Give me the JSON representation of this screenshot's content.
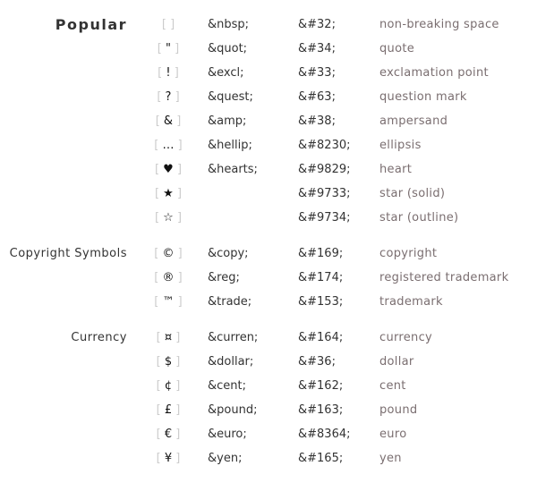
{
  "groups": [
    {
      "label": "Popular",
      "rows": [
        {
          "char": " ",
          "entity": "&nbsp;",
          "code": "&#32;",
          "desc": "non-breaking space"
        },
        {
          "char": "\"",
          "entity": "&quot;",
          "code": "&#34;",
          "desc": "quote"
        },
        {
          "char": "!",
          "entity": "&excl;",
          "code": "&#33;",
          "desc": "exclamation point"
        },
        {
          "char": "?",
          "entity": "&quest;",
          "code": "&#63;",
          "desc": "question mark"
        },
        {
          "char": "&",
          "entity": "&amp;",
          "code": "&#38;",
          "desc": "ampersand"
        },
        {
          "char": "…",
          "entity": "&hellip;",
          "code": "&#8230;",
          "desc": "ellipsis"
        },
        {
          "char": "♥",
          "entity": "&hearts;",
          "code": "&#9829;",
          "desc": "heart"
        },
        {
          "char": "★",
          "entity": "",
          "code": "&#9733;",
          "desc": "star (solid)"
        },
        {
          "char": "☆",
          "entity": "",
          "code": "&#9734;",
          "desc": "star (outline)"
        }
      ]
    },
    {
      "label": "Copyright Symbols",
      "rows": [
        {
          "char": "©",
          "entity": "&copy;",
          "code": "&#169;",
          "desc": "copyright"
        },
        {
          "char": "®",
          "entity": "&reg;",
          "code": "&#174;",
          "desc": "registered trademark"
        },
        {
          "char": "™",
          "entity": "&trade;",
          "code": "&#153;",
          "desc": "trademark"
        }
      ]
    },
    {
      "label": "Currency",
      "rows": [
        {
          "char": "¤",
          "entity": "&curren;",
          "code": "&#164;",
          "desc": "currency"
        },
        {
          "char": "$",
          "entity": "&dollar;",
          "code": "&#36;",
          "desc": "dollar"
        },
        {
          "char": "¢",
          "entity": "&cent;",
          "code": "&#162;",
          "desc": "cent"
        },
        {
          "char": "£",
          "entity": "&pound;",
          "code": "&#163;",
          "desc": "pound"
        },
        {
          "char": "€",
          "entity": "&euro;",
          "code": "&#8364;",
          "desc": "euro"
        },
        {
          "char": "¥",
          "entity": "&yen;",
          "code": "&#165;",
          "desc": "yen"
        }
      ]
    }
  ]
}
